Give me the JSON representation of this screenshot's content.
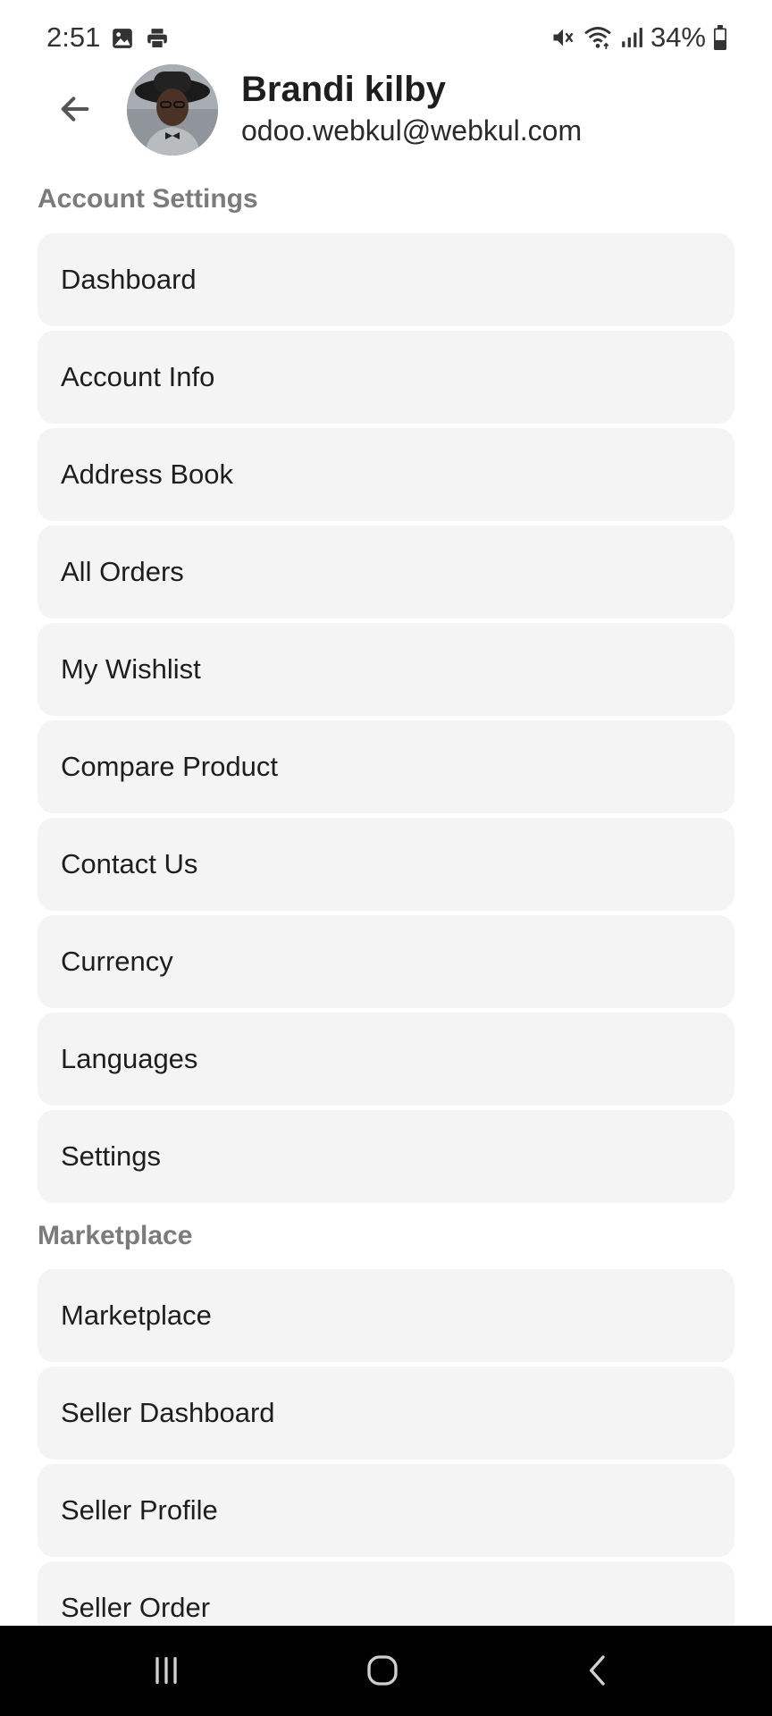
{
  "status_bar": {
    "time": "2:51",
    "battery": "34%",
    "icons_left": [
      "image-icon",
      "print-icon"
    ],
    "icons_right": [
      "mute-icon",
      "wifi-icon",
      "signal-icon",
      "battery-icon"
    ]
  },
  "header": {
    "back_icon": "arrow-left-icon",
    "name": "Brandi kilby",
    "email": "odoo.webkul@webkul.com"
  },
  "sections": {
    "account": {
      "title": "Account Settings",
      "items": [
        "Dashboard",
        "Account Info",
        "Address Book",
        "All Orders",
        "My Wishlist",
        "Compare Product",
        "Contact Us",
        "Currency",
        "Languages",
        "Settings"
      ]
    },
    "marketplace": {
      "title": "Marketplace",
      "items": [
        "Marketplace",
        "Seller Dashboard",
        "Seller Profile",
        "Seller Order"
      ]
    }
  },
  "nav_bar": {
    "buttons": [
      "recents-icon",
      "home-icon",
      "back-icon"
    ]
  },
  "colors": {
    "item_background": "#f4f4f4",
    "section_title": "#7b7b7b",
    "nav_background": "#000000"
  }
}
